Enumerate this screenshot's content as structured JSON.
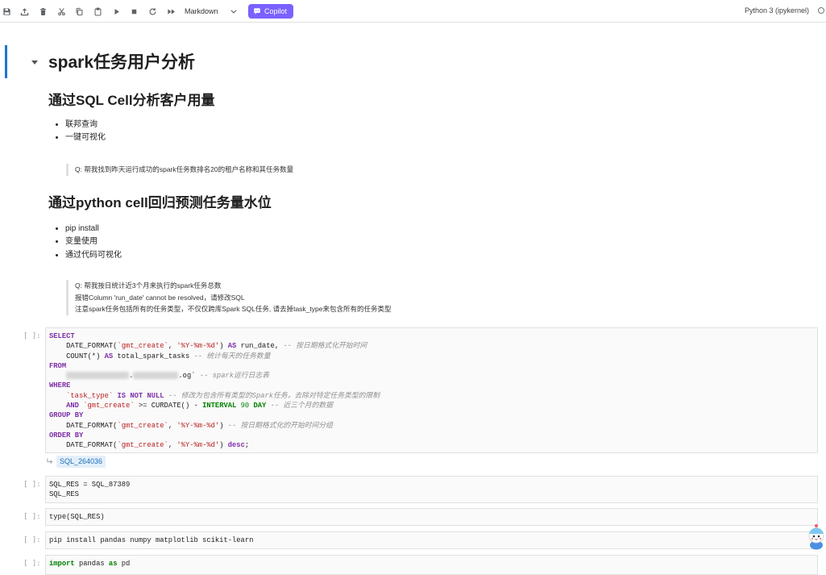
{
  "theme": {
    "accent": "#1976d2",
    "copilot": "#7b61ff",
    "keyword": "#7d2ea8",
    "keyword_alt": "#008000",
    "string": "#ba2121",
    "number": "#008000",
    "comment": "#8f8f8f",
    "chip_bg": "#e3effb",
    "chip_text": "#1f6fb8"
  },
  "toolbar": {
    "icons": [
      "save-icon",
      "upload-icon",
      "delete-icon",
      "cut-icon",
      "copy-icon",
      "paste-icon",
      "run-icon",
      "stop-icon",
      "restart-icon",
      "run-all-icon"
    ],
    "cell_type": "Markdown",
    "copilot_label": "Copilot",
    "kernel_name": "Python 3 (ipykernel)"
  },
  "markdown": {
    "h1": "spark任务用户分析",
    "section1": {
      "heading": "通过SQL Cell分析客户用量",
      "bullets": [
        "联邦查询",
        "一键可视化"
      ],
      "quote": [
        "Q: 帮我找到昨天运行成功的spark任务数排名20的租户名称和其任务数量"
      ]
    },
    "section2": {
      "heading": "通过python cell回归预测任务量水位",
      "bullets": [
        "pip install",
        "变量使用",
        "通过代码可视化"
      ],
      "quote": [
        "Q: 帮我按日统计近3个月来执行的spark任务总数",
        "报错Column 'run_date' cannot be resolved，请修改SQL",
        "注意spark任务包括所有的任务类型，不仅仅跨库Spark SQL任务, 请去掉task_type来包含所有的任务类型"
      ]
    }
  },
  "cells": [
    {
      "prompt": "[ ]:",
      "lines": [
        "SELECT",
        "    DATE_FORMAT(`gmt_create`, '%Y-%m-%d') AS run_date, -- 按日期格式化开始时间",
        "    COUNT(*) AS total_spark_tasks -- 统计每天的任务数量",
        "FROM",
        [
          "    ",
          null,
          ".",
          null,
          ".og` -- spark运行日志表"
        ],
        "WHERE",
        "    `task_type` IS NOT NULL -- 修改为包含所有类型的Spark任务，去除对特定任务类型的限制",
        "    AND `gmt_create` >= CURDATE() - INTERVAL 90 DAY -- 近三个月的数据",
        "GROUP BY",
        "    DATE_FORMAT(`gmt_create`, '%Y-%m-%d') -- 按日期格式化的开始时间分组",
        "ORDER BY",
        "    DATE_FORMAT(`gmt_create`, '%Y-%m-%d') desc;"
      ],
      "output": "SQL_264036"
    },
    {
      "prompt": "[ ]:",
      "lines": [
        "SQL_RES = SQL_87389",
        "SQL_RES"
      ]
    },
    {
      "prompt": "[ ]:",
      "lines": [
        "type(SQL_RES)"
      ]
    },
    {
      "prompt": "[ ]:",
      "lines": [
        "pip install pandas numpy matplotlib scikit-learn"
      ]
    },
    {
      "prompt": "[ ]:",
      "lines": [
        "import pandas as pd"
      ]
    }
  ]
}
